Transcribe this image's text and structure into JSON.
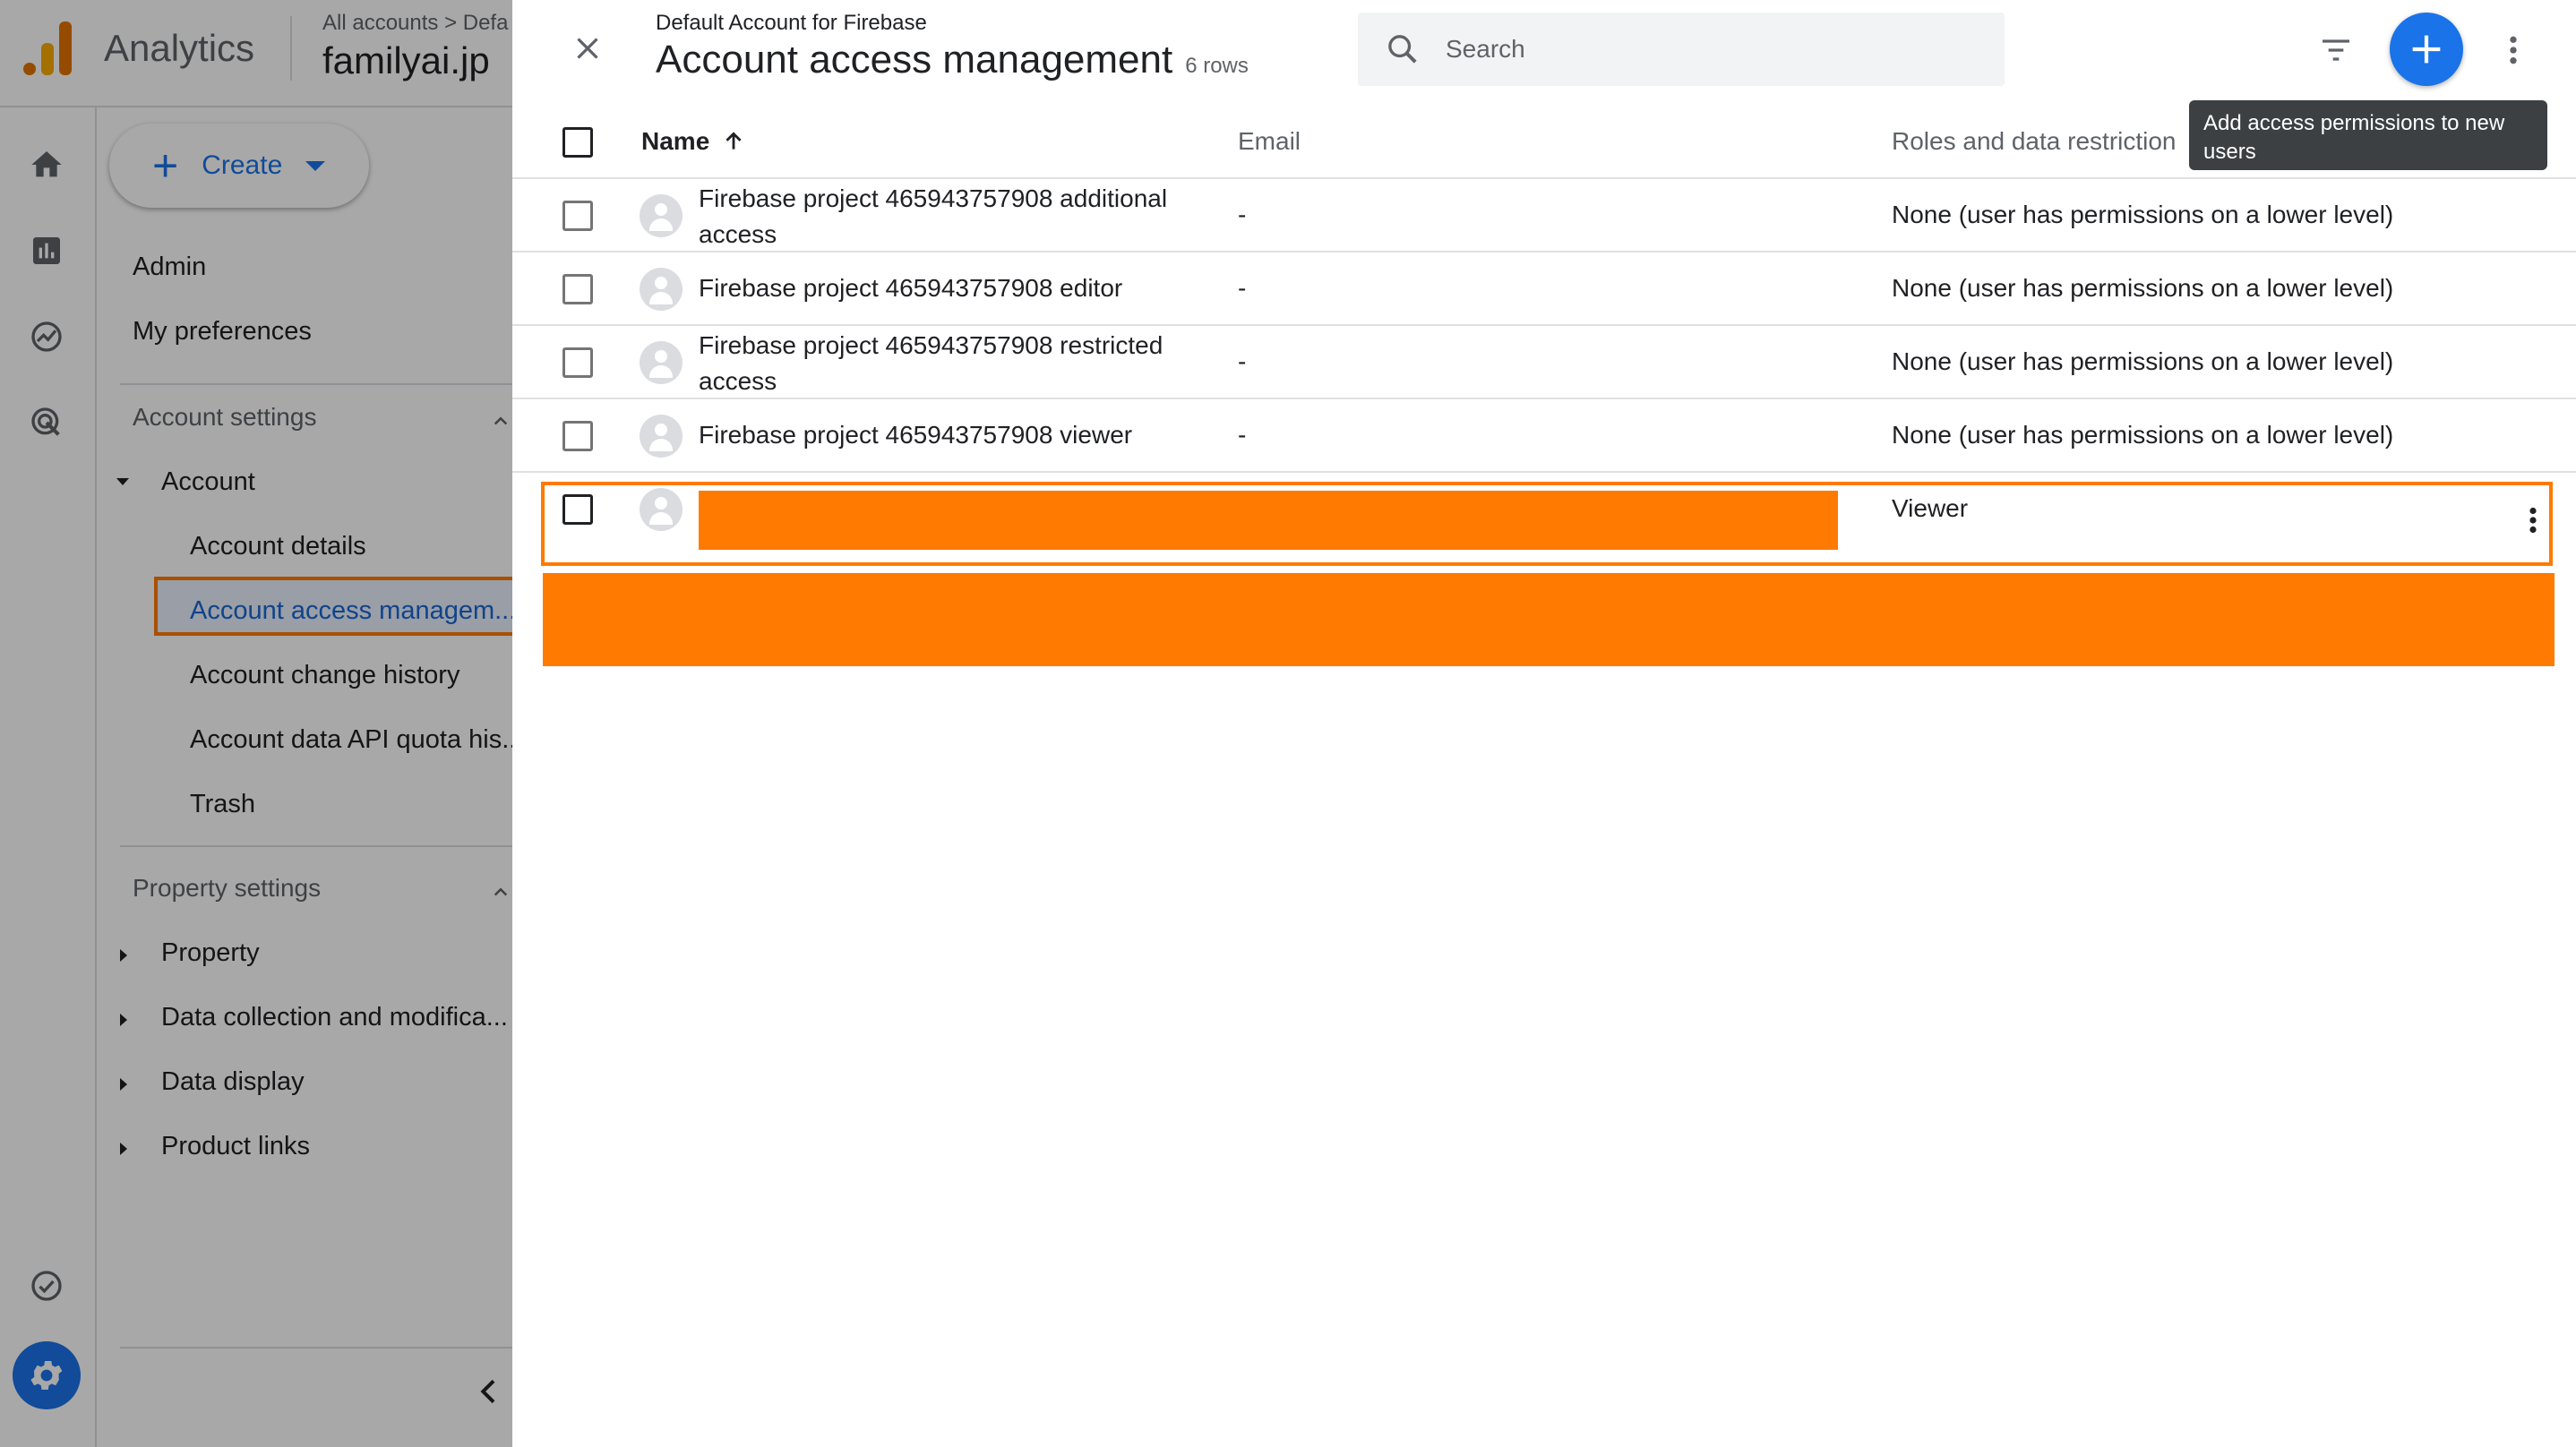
{
  "app": {
    "product_name": "Analytics",
    "breadcrumb": "All accounts > Defa",
    "property_name": "familyai.jp"
  },
  "nav": {
    "create_label": "Create",
    "admin": "Admin",
    "my_preferences": "My preferences",
    "account_settings": "Account settings",
    "account": "Account",
    "account_details": "Account details",
    "account_access_management": "Account access managem...",
    "account_change_history": "Account change history",
    "account_data_api": "Account data API quota his...",
    "trash": "Trash",
    "property_settings": "Property settings",
    "property": "Property",
    "data_collection": "Data collection and modifica...",
    "data_display": "Data display",
    "product_links": "Product links"
  },
  "panel": {
    "subtitle": "Default Account for Firebase",
    "title": "Account access management",
    "rows_count": "6 rows",
    "search_placeholder": "Search",
    "tooltip": "Add access permissions to new users"
  },
  "table": {
    "headers": {
      "name": "Name",
      "email": "Email",
      "roles": "Roles and data restriction"
    },
    "rows": [
      {
        "name": "Firebase project 465943757908 additional access",
        "email": "-",
        "role": "None (user has permissions on a lower level)"
      },
      {
        "name": "Firebase project 465943757908 editor",
        "email": "-",
        "role": "None (user has permissions on a lower level)"
      },
      {
        "name": "Firebase project 465943757908 restricted access",
        "email": "-",
        "role": "None (user has permissions on a lower level)"
      },
      {
        "name": "Firebase project 465943757908 viewer",
        "email": "-",
        "role": "None (user has permissions on a lower level)"
      },
      {
        "name": "",
        "email": "",
        "role": "Viewer"
      }
    ]
  },
  "colors": {
    "accent": "#1a73e8",
    "highlight": "#ff7a00",
    "logo_orange": "#f9ab00",
    "logo_dark_orange": "#e37400"
  }
}
